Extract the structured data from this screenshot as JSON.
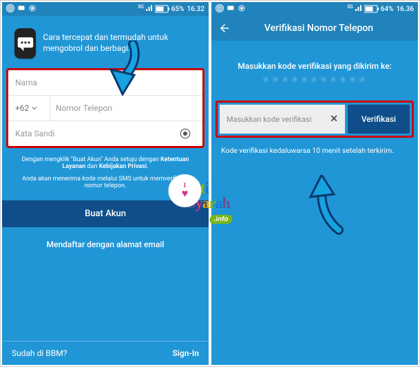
{
  "left": {
    "statusbar": {
      "time": "16.32",
      "battery": "65%"
    },
    "intro": "Cara tercepat dan termudah untuk mengobrol dan berbagi.",
    "fields": {
      "name_ph": "Nama",
      "cc": "+62",
      "phone_ph": "Nomor Telepon",
      "pass_ph": "Kata Sandi"
    },
    "legal1a": "Dengan mengklik \"Buat Akun\" Anda setuju dengan ",
    "legal1b": "Ketentuan Layanan",
    "legal1c": " dan ",
    "legal1d": "Kebijakan Privasi",
    "legal2": "Anda akan menerima kode melalui SMS untuk memverifikasi nomor telepon.",
    "cta": "Buat Akun",
    "alt": "Mendaftar dengan alamat email",
    "already": "Sudah di BBM?",
    "signin": "Sign-In"
  },
  "right": {
    "statusbar": {
      "time": "16.36",
      "battery": "64%"
    },
    "title": "Verifikasi Nomor Telepon",
    "prompt": "Masukkan kode verifikasi yang dikirim ke:",
    "masked": "＊＊＊＊＊＊＊＊＊＊＊",
    "input_ph": "Masukkan kode verifikasi",
    "btn": "Verifikasi",
    "hint": "Kode verifikasi kedaluwarsa 10 menit setelah terkirim."
  },
  "watermark": {
    "badge": "I ♥",
    "line1": "Siti",
    "line2": "Syarah",
    "tag": ".info"
  }
}
